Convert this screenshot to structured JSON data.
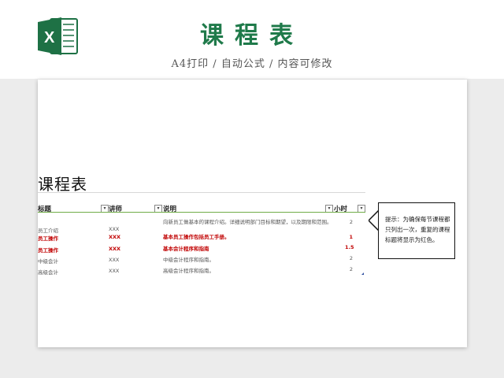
{
  "header": {
    "app_icon": "excel-icon",
    "title": "课程表",
    "subtitle": "A4打印 / 自动公式 / 内容可修改"
  },
  "sheet": {
    "title": "课程表",
    "columns": [
      "标题",
      "讲师",
      "说明",
      "小时"
    ],
    "rows": [
      {
        "title": "员工介绍",
        "teacher": "XXX",
        "desc": "向新员工做基本的课程介绍。详细说明部门目标和期望，以及期限和范围。",
        "hours": "2",
        "highlight": false
      },
      {
        "title": "员工操作",
        "teacher": "XXX",
        "desc": "基本员工操作包括员工手册。",
        "hours": "1",
        "highlight": true
      },
      {
        "title": "员工操作",
        "teacher": "XXX",
        "desc": "基本会计程序和指南",
        "hours": "1.5",
        "highlight": true
      },
      {
        "title": "中级会计",
        "teacher": "XXX",
        "desc": "中级会计程序和指南。",
        "hours": "2",
        "highlight": false
      },
      {
        "title": "高级会计",
        "teacher": "XXX",
        "desc": "高级会计程序和指南。",
        "hours": "2",
        "highlight": false
      }
    ],
    "note": "提示：为确保每节课程都只列出一次，重复的课程标题将显示为红色。"
  },
  "colors": {
    "brand_green": "#1f7a4a",
    "header_line": "#70ad47",
    "highlight_red": "#c00000"
  }
}
